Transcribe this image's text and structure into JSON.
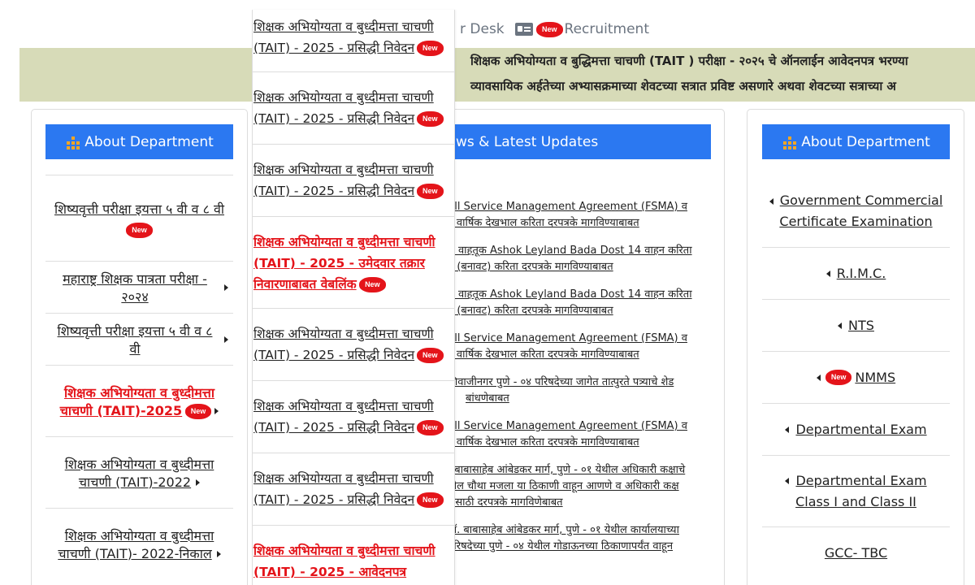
{
  "nav": {
    "desk_partial": "r Desk",
    "recruitment": "Recruitment",
    "new_badge": "New"
  },
  "marquee": {
    "line1": "शिक्षक अभियोग्यता व बुद्धिमत्ता चाचणी (TAIT ) परीक्षा - २०२५ चे ऑनलाईन आवेदनपत्र भरण्या",
    "line2": "व्यावसायिक अर्हतेच्या अभ्यासक्रमाच्या शेवटच्या सत्रात प्रविष्ट असणारे अथवा शेवटच्या सत्राच्या अ"
  },
  "left_panel": {
    "title": "About Department",
    "items": [
      {
        "label": "शिष्यवृत्ती परीक्षा इयत्ता ५ वी व ८ वी",
        "new": true,
        "arrow": false,
        "red": false
      },
      {
        "label": "महाराष्ट्र शिक्षक पात्रता परीक्षा - २०२४",
        "new": false,
        "arrow": true,
        "red": false
      },
      {
        "label": "शिष्यवृत्ती परीक्षा इयत्ता ५ वी व ८ वी",
        "new": false,
        "arrow": true,
        "red": false
      },
      {
        "label": "शिक्षक अभियोग्यता व बुध्दीमत्ता चाचणी (TAIT)-2025",
        "new": true,
        "arrow": true,
        "red": true
      },
      {
        "label": "शिक्षक अभियोग्यता व बुध्दीमत्ता चाचणी (TAIT)-2022",
        "new": false,
        "arrow": true,
        "red": false
      },
      {
        "label": "शिक्षक अभियोग्यता व बुध्दीमत्ता चाचणी (TAIT)- 2022-निकाल",
        "new": false,
        "arrow": true,
        "red": false
      }
    ]
  },
  "middle_panel": {
    "title_partial": "ws & Latest Updates",
    "news": [
      {
        "l1": "ull Service Management Agreement (FSMA) व",
        "l2": "s वार्षिक देखभाल करिता दरपत्रके मागविण्याबाबत"
      },
      {
        "l1": "ल वाहतूक Ashok Leyland Bada Dost 14 वाहन करिता",
        "l2": "न (बनावट) करिता दरपत्रके मागविण्याबाबत"
      },
      {
        "l1": "ल वाहतूक Ashok Leyland Bada Dost 14 वाहन करिता",
        "l2": "न (बनावट) करिता दरपत्रके मागविण्याबाबत"
      },
      {
        "l1": "ull Service Management Agreement (FSMA) व",
        "l2": "s वार्षिक देखभाल करिता दरपत्रके मागविण्याबाबत"
      },
      {
        "l1": "शिवाजीनगर पुणे - ०४ परिषदेच्या जागेत तात्पुरते पत्र्याचे शेड",
        "l2": "बांधणेबाबत"
      },
      {
        "l1": "ull Service Management Agreement (FSMA) व",
        "l2": "s वार्षिक देखभाल करिता दरपत्रके मागविण्याबाबत"
      },
      {
        "l1": ". बाबासाहेब आंबेडकर मार्ग, पुणे - ०१ येथील अधिकारी कक्षाचे",
        "l2": "ील चौथा मजला या ठिकाणी वाहून आणणे व अधिकारी कक्ष",
        "l3": "णेसाठी दरपत्रके मागविणेबाबत"
      },
      {
        "l1": "ॉ. बाबासाहेब आंबेडकर मार्ग, पुणे - ०१ येथील कार्यालयाच्या",
        "l2": "परिषदेच्या पुणे - ०४ येथील गोडाऊनच्या ठिकाणापर्यंत वाहून"
      }
    ]
  },
  "right_panel": {
    "title": "About Department",
    "items": [
      {
        "label": "Government Commercial Certificate Examination",
        "new": false,
        "arrow": true
      },
      {
        "label": "R.I.M.C.",
        "new": false,
        "arrow": true
      },
      {
        "label": "NTS",
        "new": false,
        "arrow": true
      },
      {
        "label": "NMMS",
        "new": true,
        "arrow": true
      },
      {
        "label": "Departmental Exam",
        "new": false,
        "arrow": true
      },
      {
        "label": "Departmental Exam Class I and Class II",
        "new": false,
        "arrow": true
      },
      {
        "label": "GCC- TBC",
        "new": false,
        "arrow": false
      }
    ]
  },
  "dropdown": {
    "items": [
      {
        "label": "शिक्षक अभियोग्यता व बुध्दीमत्ता चाचणी (TAIT) - 2025 - प्रसिद्धी निवेदन",
        "new": true,
        "red": false
      },
      {
        "label": "शिक्षक अभियोग्यता व बुध्दीमत्ता चाचणी (TAIT) - 2025 - प्रसिद्धी निवेदन",
        "new": true,
        "red": false
      },
      {
        "label": "शिक्षक अभियोग्यता व बुध्दीमत्ता चाचणी (TAIT) - 2025 - प्रसिद्धी निवेदन",
        "new": true,
        "red": false
      },
      {
        "label": "शिक्षक अभियोग्यता व बुध्दीमत्ता चाचणी (TAIT) - 2025 - उमेदवार तक्रार निवारणाबाबत वेबलिंक",
        "new": true,
        "red": true
      },
      {
        "label": "शिक्षक अभियोग्यता व बुध्दीमत्ता चाचणी (TAIT) - 2025 - प्रसिद्धी निवेदन",
        "new": true,
        "red": false
      },
      {
        "label": "शिक्षक अभियोग्यता व बुध्दीमत्ता चाचणी (TAIT) - 2025 - प्रसिद्धी निवेदन",
        "new": true,
        "red": false
      },
      {
        "label": "शिक्षक अभियोग्यता व बुध्दीमत्ता चाचणी (TAIT) - 2025 - प्रसिद्धी निवेदन",
        "new": true,
        "red": false
      },
      {
        "label": "शिक्षक अभियोग्यता व बुध्दीमत्ता चाचणी (TAIT) - 2025 - आवेदनपत्र",
        "new": false,
        "red": true
      }
    ]
  },
  "colors": {
    "accent": "#2b78f1",
    "marquee_bg": "#d7dbb8",
    "new_red": "#e4141a"
  }
}
